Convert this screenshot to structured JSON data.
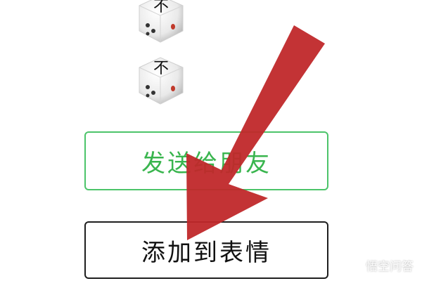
{
  "stickers": [
    {
      "name": "dice-sticker",
      "face_text": "不"
    },
    {
      "name": "dice-sticker",
      "face_text": "不"
    }
  ],
  "buttons": {
    "send_to_friend": "发送给朋友",
    "add_to_stickers": "添加到表情"
  },
  "annotation": {
    "arrow_color": "#c0282a",
    "points_to": "add_to_stickers"
  },
  "watermark": {
    "text": "悟空问答",
    "icon": "wukong-logo-icon"
  },
  "colors": {
    "green": "#39b54e",
    "dark": "#111111"
  }
}
